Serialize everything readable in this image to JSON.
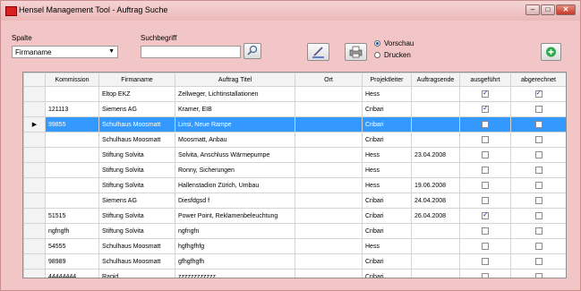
{
  "window": {
    "title": "Hensel Management Tool - Auftrag Suche",
    "close_glyph": "✕",
    "min_glyph": "–",
    "max_glyph": "□"
  },
  "filter": {
    "spalte_label": "Spalte",
    "spalte_value": "Firmaname",
    "suchbegriff_label": "Suchbegriff",
    "search_value": "",
    "radio_vorschau": "Vorschau",
    "radio_drucken": "Drucken",
    "selected_radio": "Vorschau"
  },
  "icons": {
    "search": "magnifier-icon",
    "edit": "edit-pencil-icon",
    "print": "printer-icon",
    "add": "plus-icon"
  },
  "colors": {
    "selection": "#3399ff",
    "window": "#f2c6c6",
    "add_green": "#2ea84a"
  },
  "table": {
    "row_indicator": "▶",
    "headers": [
      "Kommission",
      "Firmaname",
      "Auftrag Titel",
      "Ort",
      "Projektleiter",
      "Auftragsende",
      "ausgeführt",
      "abgerechnet"
    ],
    "rows": [
      {
        "kommission": "",
        "firmaname": "Eltop EKZ",
        "titel": "Zellweger, Lichtinstallationen",
        "ort": "",
        "projektleiter": "Hess",
        "auftragsende": "",
        "ausgefuehrt": true,
        "abgerechnet": true
      },
      {
        "kommission": "121113",
        "firmaname": "Siemens AG",
        "titel": "Kramer, EIB",
        "ort": "",
        "projektleiter": "Cribari",
        "auftragsende": "",
        "ausgefuehrt": true,
        "abgerechnet": false
      },
      {
        "kommission": "99855",
        "firmaname": "Schulhaus Moosmatt",
        "titel": "Linsi, Neue Rampe",
        "ort": "",
        "projektleiter": "Cribari",
        "auftragsende": "",
        "ausgefuehrt": false,
        "abgerechnet": false,
        "selected": true
      },
      {
        "kommission": "",
        "firmaname": "Schulhaus Moosmatt",
        "titel": "Moosmatt, Anbau",
        "ort": "",
        "projektleiter": "Cribari",
        "auftragsende": "",
        "ausgefuehrt": false,
        "abgerechnet": false
      },
      {
        "kommission": "",
        "firmaname": "Stiftung Solvita",
        "titel": "Solvita, Anschluss Wärmepumpe",
        "ort": "",
        "projektleiter": "Hess",
        "auftragsende": "23.04.2008",
        "ausgefuehrt": false,
        "abgerechnet": false
      },
      {
        "kommission": "",
        "firmaname": "Stiftung Solvita",
        "titel": "Ronny, Sicherungen",
        "ort": "",
        "projektleiter": "Hess",
        "auftragsende": "",
        "ausgefuehrt": false,
        "abgerechnet": false
      },
      {
        "kommission": "",
        "firmaname": "Stiftung Solvita",
        "titel": "Hallenstadion Zürich, Umbau",
        "ort": "",
        "projektleiter": "Hess",
        "auftragsende": "19.06.2008",
        "ausgefuehrt": false,
        "abgerechnet": false
      },
      {
        "kommission": "",
        "firmaname": "Siemens AG",
        "titel": "Diesfdgsd f",
        "ort": "",
        "projektleiter": "Cribari",
        "auftragsende": "24.04.2008",
        "ausgefuehrt": false,
        "abgerechnet": false
      },
      {
        "kommission": "51515",
        "firmaname": "Stiftung Solvita",
        "titel": "Power Point, Reklamenbeleuchtung",
        "ort": "",
        "projektleiter": "Cribari",
        "auftragsende": "26.04.2008",
        "ausgefuehrt": true,
        "abgerechnet": false
      },
      {
        "kommission": "ngfngfh",
        "firmaname": "Stiftung Solvita",
        "titel": "ngfngfn",
        "ort": "",
        "projektleiter": "Cribari",
        "auftragsende": "",
        "ausgefuehrt": false,
        "abgerechnet": false
      },
      {
        "kommission": "54555",
        "firmaname": "Schulhaus Moosmatt",
        "titel": "hgfhgfhfg",
        "ort": "",
        "projektleiter": "Hess",
        "auftragsende": "",
        "ausgefuehrt": false,
        "abgerechnet": false
      },
      {
        "kommission": "98989",
        "firmaname": "Schulhaus Moosmatt",
        "titel": "gfhgfhgfh",
        "ort": "",
        "projektleiter": "Cribari",
        "auftragsende": "",
        "ausgefuehrt": false,
        "abgerechnet": false
      },
      {
        "kommission": "44444444",
        "firmaname": "Rapid",
        "titel": "zzzzzzzzzzzz",
        "ort": "",
        "projektleiter": "Cribari",
        "auftragsende": "",
        "ausgefuehrt": false,
        "abgerechnet": false
      }
    ]
  }
}
